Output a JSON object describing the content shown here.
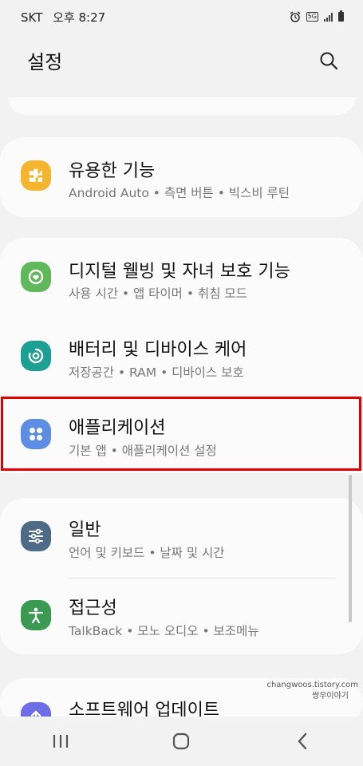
{
  "status": {
    "carrier": "SKT",
    "time": "오후 8:27",
    "network": "5G"
  },
  "header": {
    "title": "설정"
  },
  "items": [
    {
      "label": "유용한 기능",
      "sub": "Android Auto • 측면 버튼 • 빅스비 루틴",
      "icon": "puzzle-icon",
      "color": "#f5b52f"
    },
    {
      "label": "디지털 웰빙 및 자녀 보호 기능",
      "sub": "사용 시간 • 앱 타이머 • 취침 모드",
      "icon": "wellbeing-icon",
      "color": "#5fb85a"
    },
    {
      "label": "배터리 및 디바이스 케어",
      "sub": "저장공간 • RAM • 디바이스 보호",
      "icon": "device-care-icon",
      "color": "#1e9f93"
    },
    {
      "label": "애플리케이션",
      "sub": "기본 앱 • 애플리케이션 설정",
      "icon": "apps-icon",
      "color": "#5d8ee3"
    },
    {
      "label": "일반",
      "sub": "언어 및 키보드 • 날짜 및 시간",
      "icon": "sliders-icon",
      "color": "#4d6a86"
    },
    {
      "label": "접근성",
      "sub": "TalkBack • 모노 오디오 • 보조메뉴",
      "icon": "accessibility-icon",
      "color": "#3a9a52"
    },
    {
      "label": "소프트웨어 업데이트",
      "icon": "software-update-icon",
      "color": "#6c6ee6"
    }
  ],
  "watermark": {
    "line1": "changwoos.tistory.com",
    "line2": "쌍우이야기"
  },
  "colors": {
    "highlight": "#e00000"
  }
}
